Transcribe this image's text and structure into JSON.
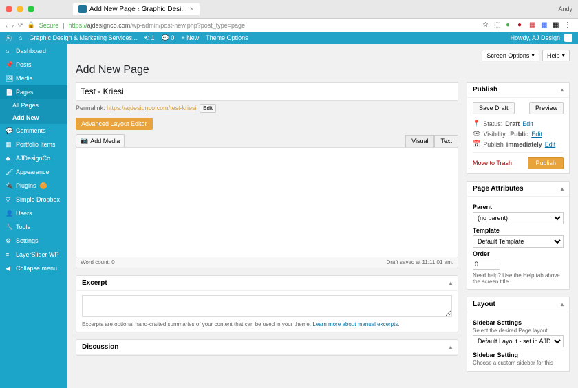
{
  "browser": {
    "tab_title": "Add New Page ‹ Graphic Desi...",
    "secure_label": "Secure",
    "url_prefix": "https://",
    "url_host": "ajdesignco.com",
    "url_path": "/wp-admin/post-new.php?post_type=page",
    "user_label": "Andy"
  },
  "adminbar": {
    "site_name": "Graphic Design & Marketing Services...",
    "updates": "1",
    "comments": "0",
    "new_label": "New",
    "theme_options": "Theme Options",
    "howdy": "Howdy, AJ Design"
  },
  "sidebar": {
    "items": [
      {
        "label": "Dashboard"
      },
      {
        "label": "Posts"
      },
      {
        "label": "Media"
      },
      {
        "label": "Pages"
      },
      {
        "label": "Comments"
      },
      {
        "label": "Portfolio Items"
      },
      {
        "label": "AJDesignCo"
      },
      {
        "label": "Appearance"
      },
      {
        "label": "Plugins"
      },
      {
        "label": "Simple Dropbox"
      },
      {
        "label": "Users"
      },
      {
        "label": "Tools"
      },
      {
        "label": "Settings"
      },
      {
        "label": "LayerSlider WP"
      },
      {
        "label": "Collapse menu"
      }
    ],
    "sub_all": "All Pages",
    "sub_add": "Add New"
  },
  "top": {
    "screen_options": "Screen Options",
    "help": "Help"
  },
  "page": {
    "heading": "Add New Page",
    "title_value": "Test - Kriesi",
    "permalink_label": "Permalink:",
    "permalink_base": "https://ajdesignco.com/",
    "permalink_slug": "test-kriesi",
    "edit_btn": "Edit",
    "alb_label": "Advanced Layout Editor",
    "add_media": "Add Media",
    "tab_visual": "Visual",
    "tab_text": "Text",
    "word_count": "Word count: 0",
    "draft_saved": "Draft saved at 11:11:01 am."
  },
  "excerpt": {
    "title": "Excerpt",
    "hint": "Excerpts are optional hand-crafted summaries of your content that can be used in your theme.",
    "link": "Learn more about manual excerpts."
  },
  "discussion": {
    "title": "Discussion"
  },
  "publish": {
    "title": "Publish",
    "save_draft": "Save Draft",
    "preview": "Preview",
    "status_label": "Status:",
    "status_value": "Draft",
    "visibility_label": "Visibility:",
    "visibility_value": "Public",
    "schedule_label": "Publish",
    "schedule_value": "immediately",
    "edit": "Edit",
    "trash": "Move to Trash",
    "publish_btn": "Publish"
  },
  "page_attrs": {
    "title": "Page Attributes",
    "parent_label": "Parent",
    "parent_value": "(no parent)",
    "template_label": "Template",
    "template_value": "Default Template",
    "order_label": "Order",
    "order_value": "0",
    "hint": "Need help? Use the Help tab above the screen title."
  },
  "layout": {
    "title": "Layout",
    "sidebar_settings": "Sidebar Settings",
    "sidebar_hint": "Select the desired Page layout",
    "sidebar_select": "Default Layout - set in AJDesign...",
    "sidebar_setting2": "Sidebar Setting",
    "sidebar_hint2": "Choose a custom sidebar for this"
  }
}
